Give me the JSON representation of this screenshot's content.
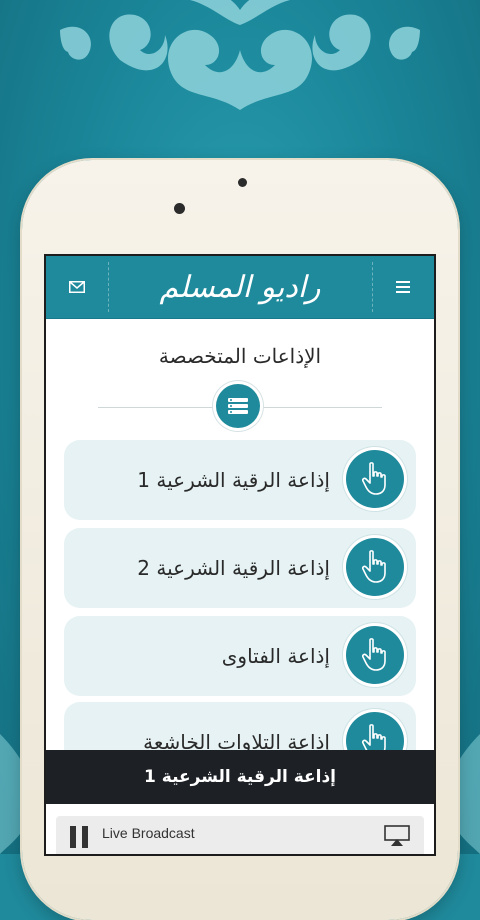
{
  "colors": {
    "accent": "#1f8a9c",
    "card": "#e6f2f3",
    "dark": "#1d2126"
  },
  "header": {
    "logo_text": "راديو المسلم",
    "menu_icon": "hamburger-icon",
    "mail_icon": "mail-icon"
  },
  "section": {
    "title": "الإذاعات المتخصصة",
    "icon": "radio-list-icon"
  },
  "stations": [
    {
      "label": "إذاعة الرقية الشرعية 1",
      "icon": "pointing-hand-icon"
    },
    {
      "label": "إذاعة الرقية الشرعية 2",
      "icon": "pointing-hand-icon"
    },
    {
      "label": "إذاعة الفتاوى",
      "icon": "pointing-hand-icon"
    },
    {
      "label": "إذاعة التلاوات الخاشعة",
      "icon": "pointing-hand-icon"
    }
  ],
  "now_playing": {
    "title": "إذاعة الرقية الشرعية 1"
  },
  "player": {
    "status": "Live Broadcast",
    "pause_icon": "pause-icon",
    "airplay_icon": "airplay-icon"
  }
}
